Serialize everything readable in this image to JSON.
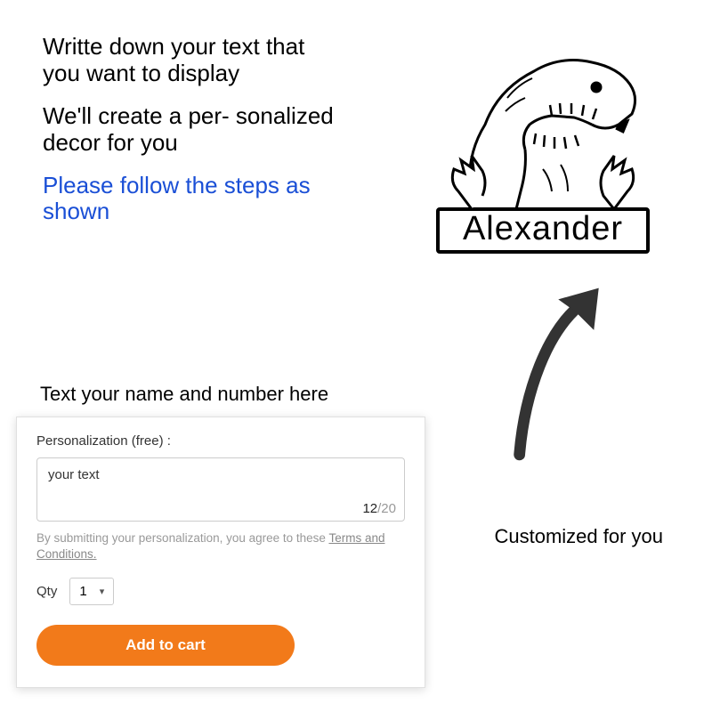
{
  "instructions": {
    "line1": "Writte down your text that you want to display",
    "line2": "We'll create a per- sonalized decor for you",
    "line3": "Please follow the steps as shown"
  },
  "product": {
    "nameplate": "Alexander"
  },
  "arrow": {
    "caption": "Customized for you"
  },
  "form": {
    "title": "Text your name and number here",
    "label": "Personalization (free) :",
    "input_value": "your text",
    "count_current": "12",
    "count_max": "/20",
    "terms_prefix": "By submitting your personalization, you agree to these ",
    "terms_link": "Terms and Conditions.",
    "qty_label": "Qty",
    "qty_value": "1",
    "add_button": "Add to cart"
  }
}
